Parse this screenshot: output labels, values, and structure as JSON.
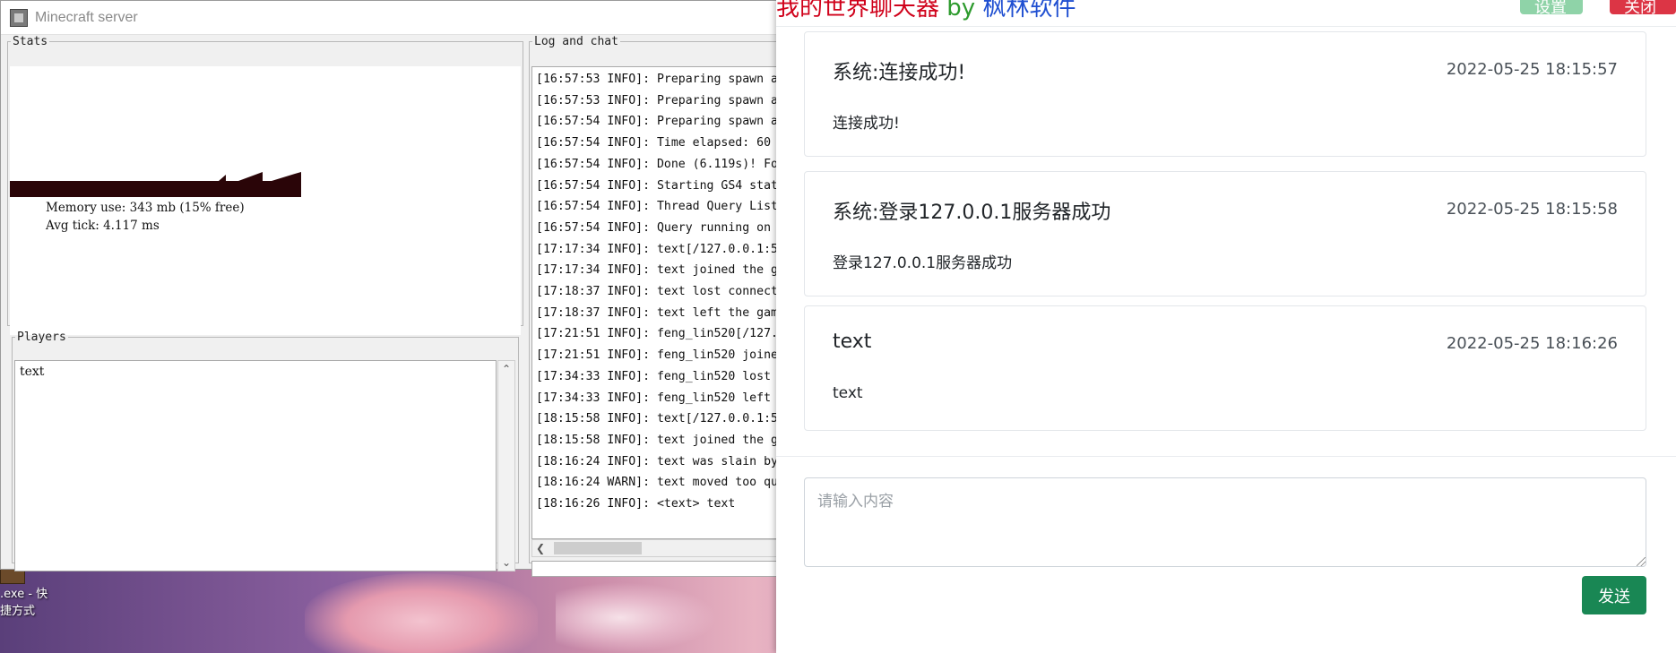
{
  "desktop": {
    "icon_label_line1": ".exe - 快",
    "icon_label_line2": "捷方式"
  },
  "mc_window": {
    "title": "Minecraft server",
    "stats": {
      "legend": "Stats",
      "memory_use": "Memory use: 343 mb (15% free)",
      "avg_tick": "Avg tick: 4.117 ms"
    },
    "players": {
      "legend": "Players",
      "list": [
        "text"
      ]
    },
    "log": {
      "legend": "Log and chat",
      "lines": [
        "[16:57:53 INFO]: Preparing spawn a",
        "[16:57:53 INFO]: Preparing spawn a",
        "[16:57:54 INFO]: Preparing spawn a",
        "[16:57:54 INFO]: Time elapsed: 60",
        "[16:57:54 INFO]: Done (6.119s)! Fo",
        "[16:57:54 INFO]: Starting GS4 stat",
        "[16:57:54 INFO]: Thread Query List",
        "[16:57:54 INFO]: Query running on",
        "[17:17:34 INFO]: text[/127.0.0.1:5",
        "[17:17:34 INFO]: text joined the g",
        "[17:18:37 INFO]: text lost connect",
        "[17:18:37 INFO]: text left the gam",
        "[17:21:51 INFO]: feng_lin520[/127.",
        "[17:21:51 INFO]: feng_lin520 joine",
        "[17:34:33 INFO]: feng_lin520 lost",
        "[17:34:33 INFO]: feng_lin520 left",
        "[18:15:58 INFO]: text[/127.0.0.1:5",
        "[18:15:58 INFO]: text joined the g",
        "[18:16:24 INFO]: text was slain by",
        "[18:16:24 WARN]: text moved too qu",
        "[18:16:26 INFO]: <text> text"
      ]
    }
  },
  "chat_panel": {
    "brand": {
      "part1": "我的世界聊天器",
      "part2": "by",
      "part3": "枫林软件"
    },
    "buttons": {
      "settings": "设置",
      "close": "关闭",
      "send": "发送"
    },
    "messages": [
      {
        "sender": "系统:连接成功!",
        "time": "2022-05-25 18:15:57",
        "body": "连接成功!"
      },
      {
        "sender": "系统:登录127.0.0.1服务器成功",
        "time": "2022-05-25 18:15:58",
        "body": "登录127.0.0.1服务器成功"
      },
      {
        "sender": "text",
        "time": "2022-05-25 18:16:26",
        "body": "text"
      }
    ],
    "input": {
      "placeholder": "请输入内容",
      "value": ""
    },
    "colors": {
      "send_button": "#198754",
      "close_button": "#dc3545",
      "settings_button": "#8fd3a8"
    }
  }
}
